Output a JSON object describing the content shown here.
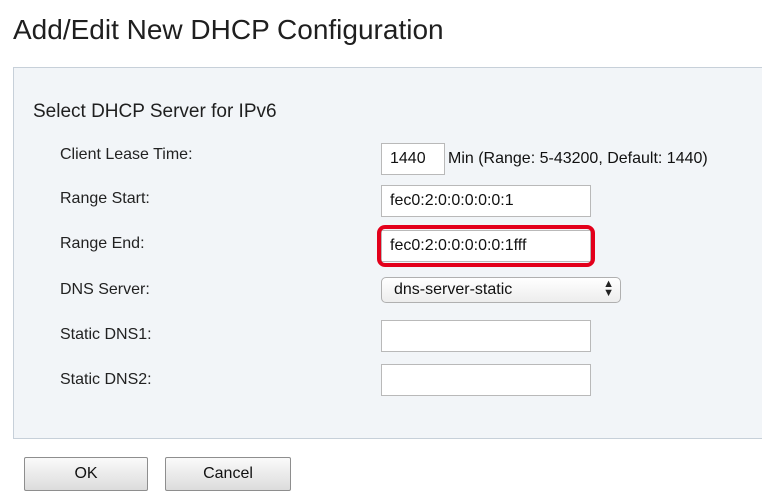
{
  "page": {
    "title": "Add/Edit New DHCP Configuration"
  },
  "section": {
    "title": "Select DHCP Server for IPv6"
  },
  "form": {
    "client_lease_time": {
      "label": "Client Lease Time:",
      "value": "1440",
      "note": "Min (Range: 5-43200, Default: 1440)"
    },
    "range_start": {
      "label": "Range Start:",
      "value": "fec0:2:0:0:0:0:0:1"
    },
    "range_end": {
      "label": "Range End:",
      "value": "fec0:2:0:0:0:0:0:1fff",
      "highlight_color": "#e3001b"
    },
    "dns_server": {
      "label": "DNS Server:",
      "value": "dns-server-static"
    },
    "static_dns1": {
      "label": "Static DNS1:",
      "value": ""
    },
    "static_dns2": {
      "label": "Static DNS2:",
      "value": ""
    }
  },
  "buttons": {
    "ok": "OK",
    "cancel": "Cancel"
  }
}
